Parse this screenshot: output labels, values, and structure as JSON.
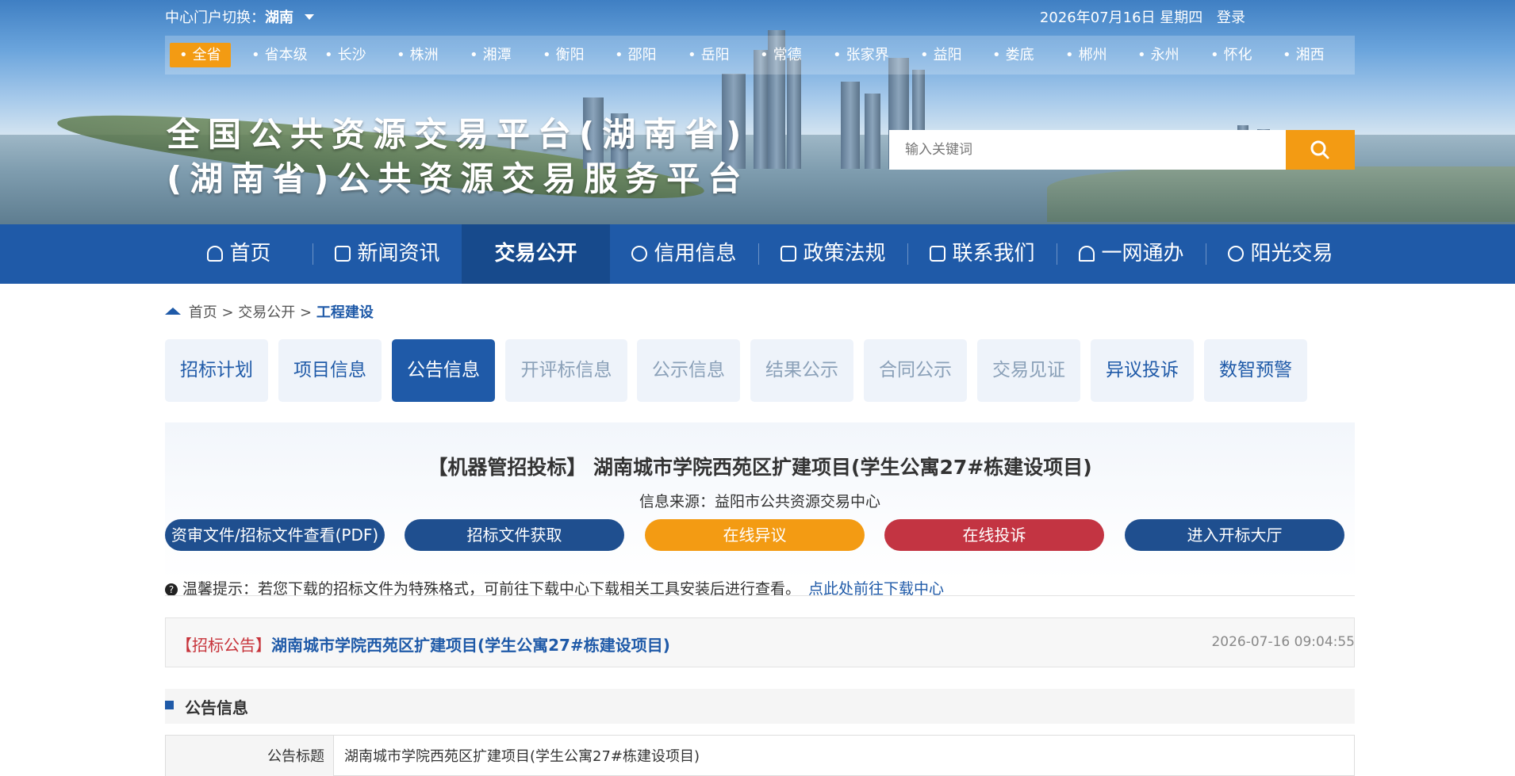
{
  "header": {
    "portal_switch_label": "中心门户切换：",
    "portal_current": "湖南",
    "date": "2026年07月16日 星期四",
    "login": "登录",
    "title_line1": "全国公共资源交易平台(湖南省)",
    "title_line2": "(湖南省)公共资源交易服务平台",
    "search_placeholder": "输入关键词"
  },
  "cities": [
    "全省",
    "省本级",
    "长沙",
    "株洲",
    "湘潭",
    "衡阳",
    "邵阳",
    "岳阳",
    "常德",
    "张家界",
    "益阳",
    "娄底",
    "郴州",
    "永州",
    "怀化",
    "湘西"
  ],
  "nav": [
    {
      "label": "首页",
      "icon": "home-icon"
    },
    {
      "label": "新闻资讯",
      "icon": "news-icon"
    },
    {
      "label": "交易公开",
      "icon": ""
    },
    {
      "label": "信用信息",
      "icon": "credit-icon"
    },
    {
      "label": "政策法规",
      "icon": "policy-icon"
    },
    {
      "label": "联系我们",
      "icon": "contact-icon"
    },
    {
      "label": "一网通办",
      "icon": "service-icon"
    },
    {
      "label": "阳光交易",
      "icon": "sunshine-icon"
    }
  ],
  "breadcrumb": {
    "home": "首页",
    "sep": ">",
    "level2": "交易公开",
    "current": "工程建设"
  },
  "tabs": [
    "招标计划",
    "项目信息",
    "公告信息",
    "开评标信息",
    "公示信息",
    "结果公示",
    "合同公示",
    "交易见证",
    "异议投诉",
    "数智预警"
  ],
  "detail": {
    "title": "【机器管招投标】 湖南城市学院西苑区扩建项目(学生公寓27#栋建设项目)",
    "source": "信息来源：益阳市公共资源交易中心",
    "buttons": [
      "资审文件/招标文件查看(PDF)",
      "招标文件获取",
      "在线异议",
      "在线投诉",
      "进入开标大厅"
    ]
  },
  "tip": {
    "text": "温馨提示：若您下载的招标文件为特殊格式，可前往下载中心下载相关工具安装后进行查看。",
    "link": "点此处前往下载中心"
  },
  "notice": {
    "type": "【招标公告】",
    "title": "湖南城市学院西苑区扩建项目(学生公寓27#栋建设项目)",
    "time": "2026-07-16 09:04:55"
  },
  "section": {
    "title": "公告信息"
  },
  "info_table": {
    "label": "公告标题",
    "value": "湖南城市学院西苑区扩建项目(学生公寓27#栋建设项目)"
  },
  "colors": {
    "primary": "#1f5aa8",
    "orange": "#f39b13",
    "red": "#c7333a",
    "nav_active": "#174a8c"
  }
}
